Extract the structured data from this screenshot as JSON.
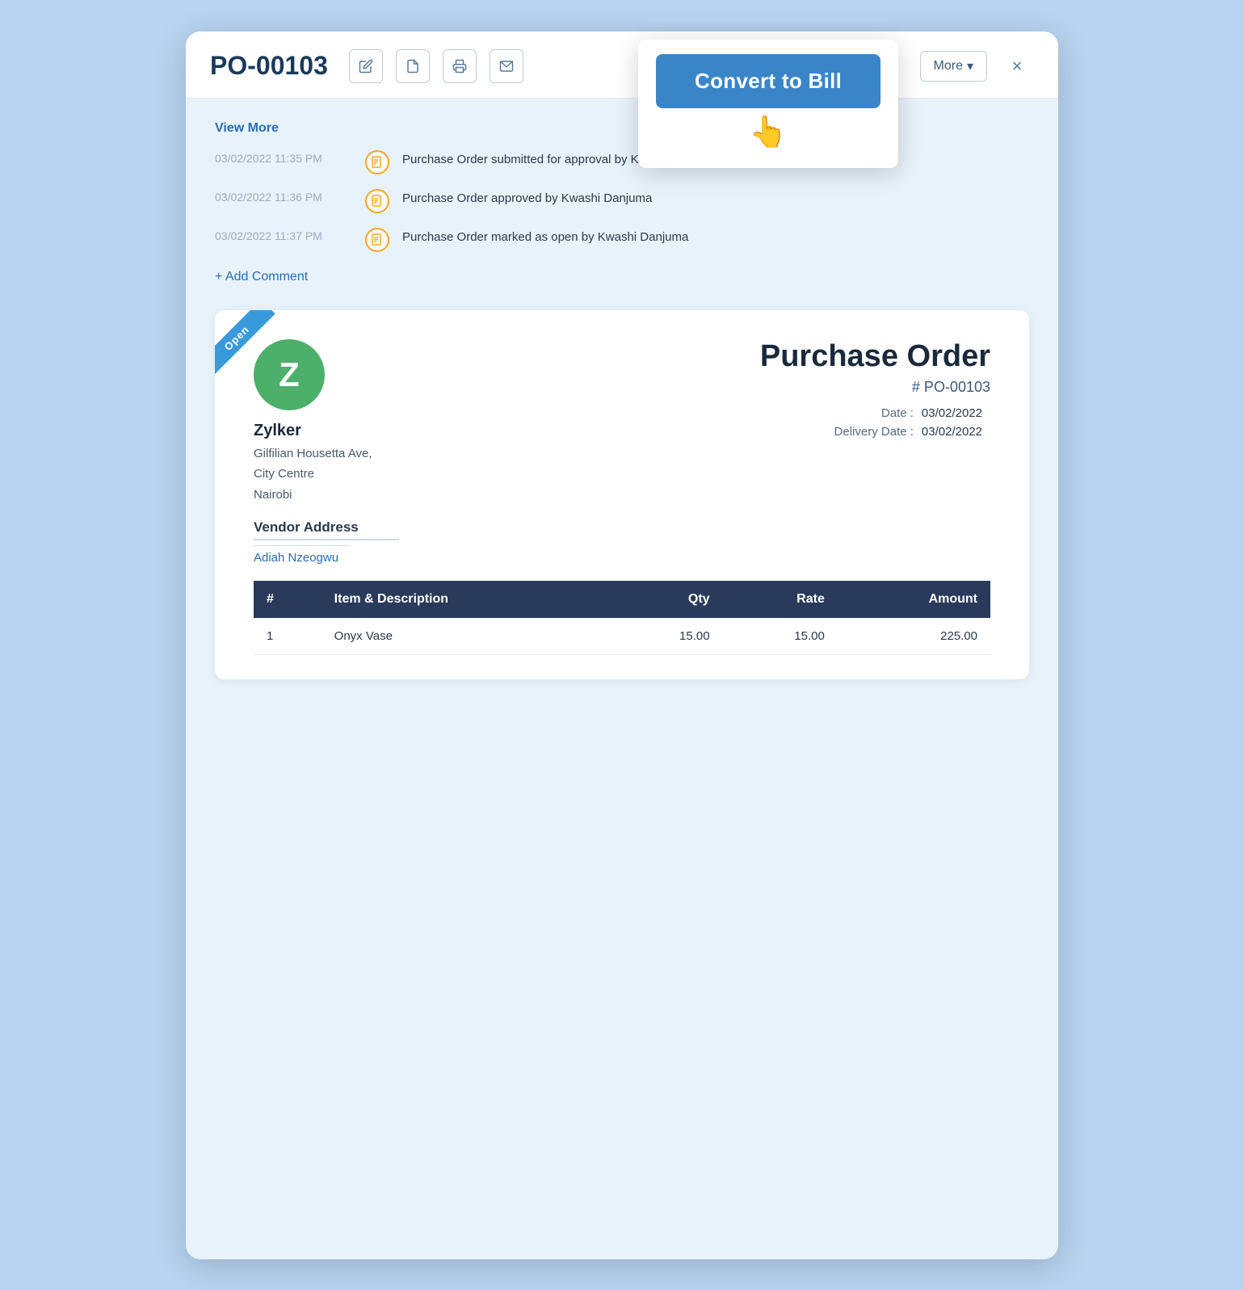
{
  "modal": {
    "title": "PO-00103",
    "close_label": "×",
    "more_label": "More",
    "convert_btn_label": "Convert to Bill"
  },
  "toolbar": {
    "edit_icon": "✎",
    "pdf_icon": "📄",
    "print_icon": "🖨",
    "email_icon": "✉"
  },
  "activity": {
    "view_more": "View More",
    "add_comment": "+ Add Comment",
    "items": [
      {
        "time": "03/02/2022 11:35 PM",
        "text": "Purchase Order submitted for approval by Kwashi Danjuma"
      },
      {
        "time": "03/02/2022 11:36 PM",
        "text": "Purchase Order approved by Kwashi Danjuma"
      },
      {
        "time": "03/02/2022 11:37 PM",
        "text": "Purchase Order marked as open by Kwashi Danjuma"
      }
    ]
  },
  "document": {
    "status_ribbon": "Open",
    "vendor_initial": "Z",
    "vendor_name": "Zylker",
    "vendor_address_line1": "Gilfilian Housetta Ave,",
    "vendor_address_line2": "City Centre",
    "vendor_address_line3": "Nairobi",
    "vendor_address_label": "Vendor Address",
    "vendor_contact": "Adiah Nzeogwu",
    "doc_title": "Purchase Order",
    "doc_number": "# PO-00103",
    "date_label": "Date :",
    "date_value": "03/02/2022",
    "delivery_date_label": "Delivery Date :",
    "delivery_date_value": "03/02/2022",
    "table_headers": [
      "#",
      "Item & Description",
      "Qty",
      "Rate",
      "Amount"
    ],
    "table_rows": [
      {
        "num": "1",
        "description": "Onyx Vase",
        "qty": "15.00",
        "rate": "15.00",
        "amount": "225.00"
      }
    ]
  }
}
